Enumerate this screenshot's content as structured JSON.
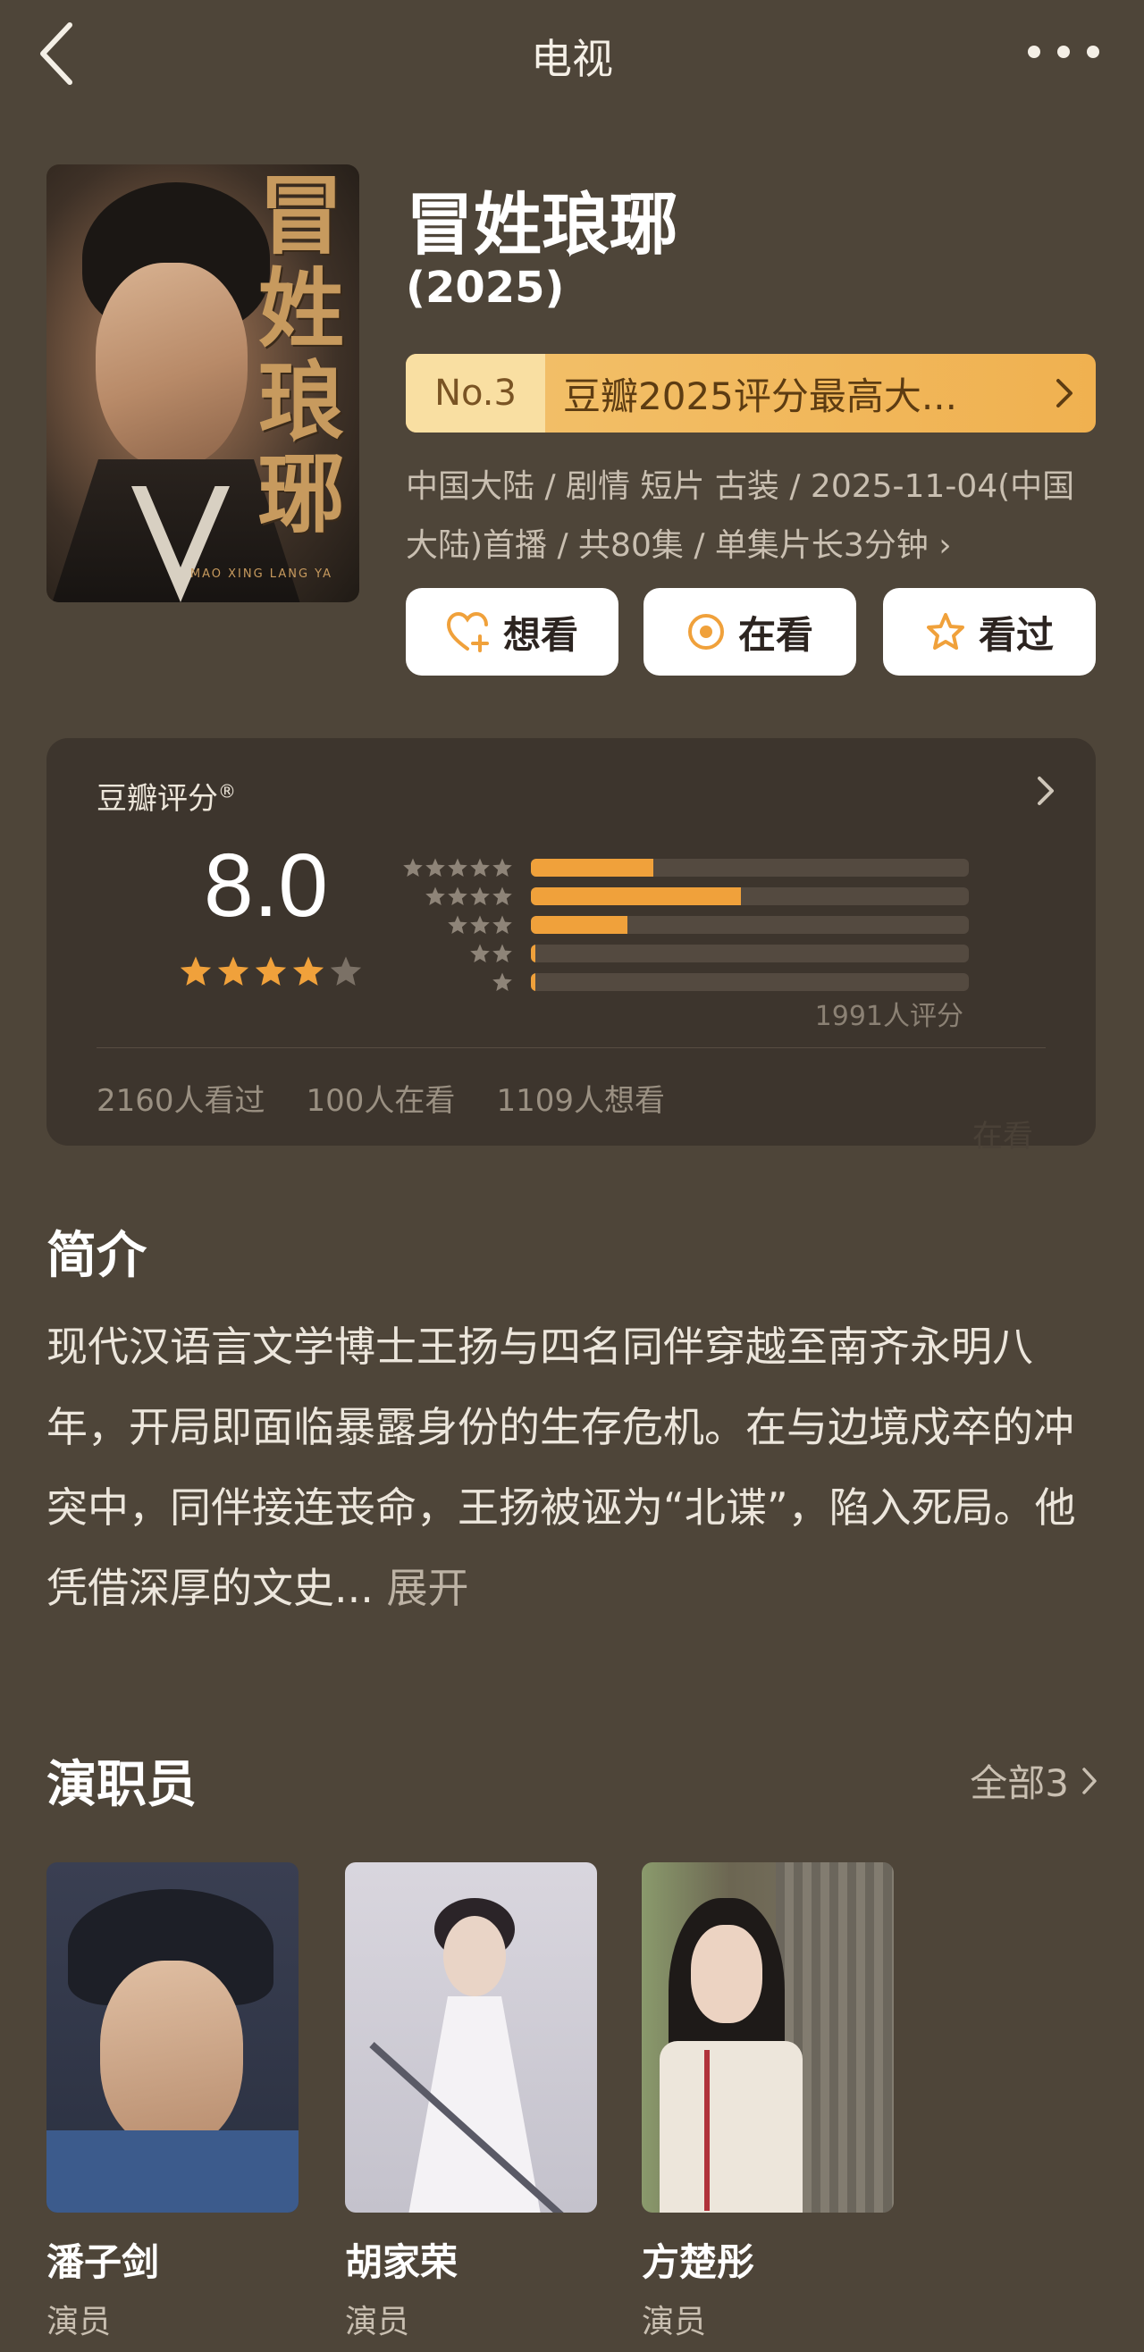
{
  "header": {
    "title": "电视"
  },
  "poster": {
    "calligraphy": [
      "冒",
      "姓",
      "琅",
      "琊"
    ],
    "english_caption": "MAO XING LANG YA"
  },
  "show": {
    "title": "冒姓琅琊",
    "year": "(2025)"
  },
  "rank_banner": {
    "rank": "No.3",
    "text": "豆瓣2025评分最高大..."
  },
  "meta": {
    "line": "中国大陆 / 剧情 短片 古装 / 2025-11-04(中国大陆)首播 / 共80集 / 单集片长3分钟 ›"
  },
  "actions": {
    "want": "想看",
    "watching": "在看",
    "watched": "看过"
  },
  "rating": {
    "label": "豆瓣评分",
    "registered_mark": "®",
    "score": "8.0",
    "score_star_level": 4,
    "distribution": [
      {
        "stars": 5,
        "percent": 28
      },
      {
        "stars": 4,
        "percent": 48
      },
      {
        "stars": 3,
        "percent": 22
      },
      {
        "stars": 2,
        "percent": 1
      },
      {
        "stars": 1,
        "percent": 1
      }
    ],
    "count_text": "1991人评分",
    "stats": {
      "watched": "2160人看过",
      "watching": "100人在看",
      "want": "1109人想看"
    },
    "watermark": "在看"
  },
  "intro": {
    "title": "简介",
    "text": "现代汉语言文学博士王扬与四名同伴穿越至南齐永明八年，开局即面临暴露身份的生存危机。在与边境戍卒的冲突中，同伴接连丧命，王扬被诬为“北谍”，陷入死局。他凭借深厚的文史...",
    "expand": "展开"
  },
  "cast": {
    "title": "演职员",
    "all_label": "全部3",
    "members": [
      {
        "name": "潘子剑",
        "role": "演员"
      },
      {
        "name": "胡家荣",
        "role": "演员"
      },
      {
        "name": "方楚彤",
        "role": "演员"
      }
    ]
  },
  "colors": {
    "background": "#4e4539",
    "card": "#3d352d",
    "accent": "#f0a13b",
    "banner": "#f0b150"
  }
}
